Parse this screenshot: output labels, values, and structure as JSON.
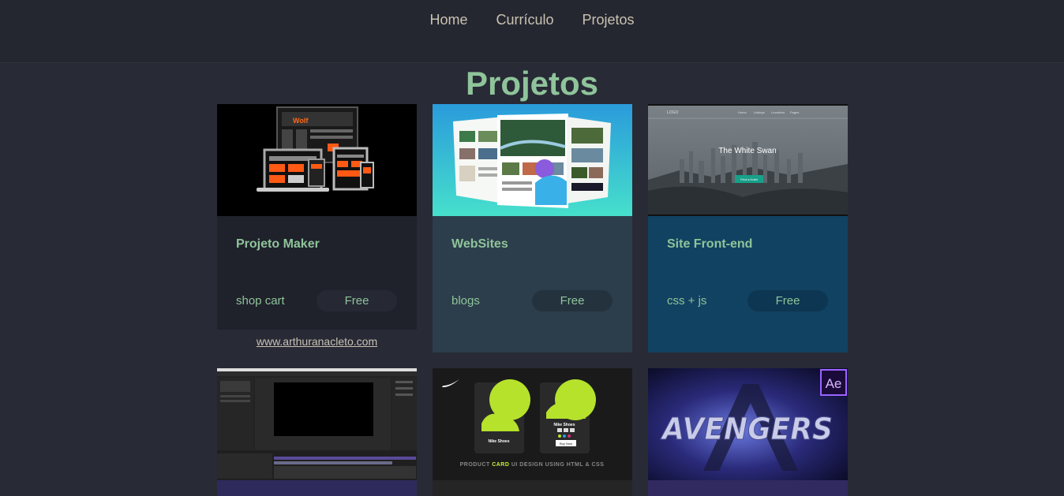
{
  "nav": {
    "items": [
      {
        "label": "Home"
      },
      {
        "label": "Currículo"
      },
      {
        "label": "Projetos"
      }
    ]
  },
  "page": {
    "title": "Projetos"
  },
  "cards": [
    {
      "title": "Projeto Maker",
      "tag": "shop cart",
      "price": "Free",
      "logo_text": "Wolf",
      "color": "#1f212b"
    },
    {
      "title": "WebSites",
      "tag": "blogs",
      "price": "Free",
      "color": "#2c3e4c"
    },
    {
      "title": "Site Front-end",
      "tag": "css + js",
      "price": "Free",
      "thumb_title": "The White Swan",
      "thumb_nav": [
        "Home",
        "Listings",
        "Locations",
        "Pages"
      ],
      "thumb_logo": "LOGO",
      "thumb_button": "Find a Hotel",
      "color": "#124261"
    }
  ],
  "link": {
    "label": "www.arthuranacleto.com"
  },
  "cards_row2": [
    {
      "name": "after-effects-editor",
      "color": "#2f2a5c"
    },
    {
      "name": "nike-product-card",
      "thumb_caption_a": "PRODUCT ",
      "thumb_caption_b": "CARD",
      "thumb_caption_c": " UI DESIGN USING HTML & CSS",
      "card_label_1": "Nike Shoes",
      "card_label_2": "Nike Shoes",
      "buy_label": "Buy Now",
      "color": "#252525"
    },
    {
      "name": "avengers",
      "thumb_title": "AVENGERS",
      "badge": "Ae",
      "color": "#302a60"
    }
  ]
}
